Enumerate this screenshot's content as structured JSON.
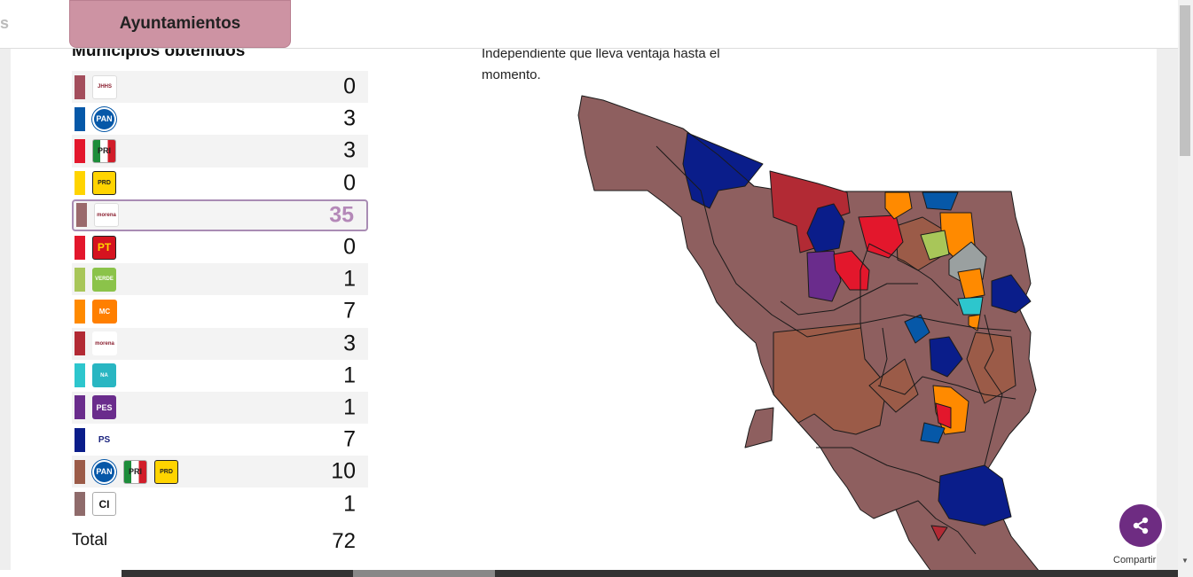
{
  "tabs": {
    "previous_label_fragment": "s",
    "active_label": "Ayuntamientos"
  },
  "section": {
    "title": "Municipios obtenidos"
  },
  "parties": [
    {
      "logos": [
        "coalition-logo"
      ],
      "color": "#a34e5c",
      "count": "0",
      "logo_text": [
        "JHHS"
      ]
    },
    {
      "logos": [
        "pan-logo"
      ],
      "color": "#0658a8",
      "count": "3",
      "logo_text": [
        "PAN"
      ]
    },
    {
      "logos": [
        "pri-logo"
      ],
      "color": "#e3172c",
      "count": "3",
      "logo_text": [
        "PRI"
      ]
    },
    {
      "logos": [
        "prd-logo"
      ],
      "color": "#ffd400",
      "count": "0",
      "logo_text": [
        "PRD"
      ]
    },
    {
      "logos": [
        "morena-coalition-logo"
      ],
      "color": "#9a6a6c",
      "count": "35",
      "logo_text": [
        "morena"
      ]
    },
    {
      "logos": [
        "pt-logo"
      ],
      "color": "#e3172c",
      "count": "0",
      "logo_text": [
        "PT"
      ]
    },
    {
      "logos": [
        "verde-logo"
      ],
      "color": "#a8c659",
      "count": "1",
      "logo_text": [
        "VERDE"
      ]
    },
    {
      "logos": [
        "mc-logo"
      ],
      "color": "#ff8a00",
      "count": "7",
      "logo_text": [
        "MC"
      ]
    },
    {
      "logos": [
        "morena-logo"
      ],
      "color": "#b22a34",
      "count": "3",
      "logo_text": [
        "morena"
      ]
    },
    {
      "logos": [
        "panal-logo"
      ],
      "color": "#2dc6cd",
      "count": "1",
      "logo_text": [
        "NA"
      ]
    },
    {
      "logos": [
        "pes-logo"
      ],
      "color": "#6a2c8c",
      "count": "1",
      "logo_text": [
        "PES"
      ]
    },
    {
      "logos": [
        "ps-logo"
      ],
      "color": "#0a1d8a",
      "count": "7",
      "logo_text": [
        "PS"
      ]
    },
    {
      "logos": [
        "pan-logo",
        "pri-logo",
        "prd-logo"
      ],
      "color": "#9b5b48",
      "count": "10",
      "logo_text": [
        "PAN",
        "PRI",
        "PRD"
      ]
    },
    {
      "logos": [
        "ci-logo"
      ],
      "color": "#8f6b6b",
      "count": "1",
      "logo_text": [
        "CI"
      ]
    }
  ],
  "total": {
    "label": "Total",
    "value": "72"
  },
  "map": {
    "description_fragment": "Independiente que lleva ventaja hasta el",
    "description_line2": "momento."
  },
  "share": {
    "label": "Compartir"
  },
  "highlight_color": "#b488b8"
}
